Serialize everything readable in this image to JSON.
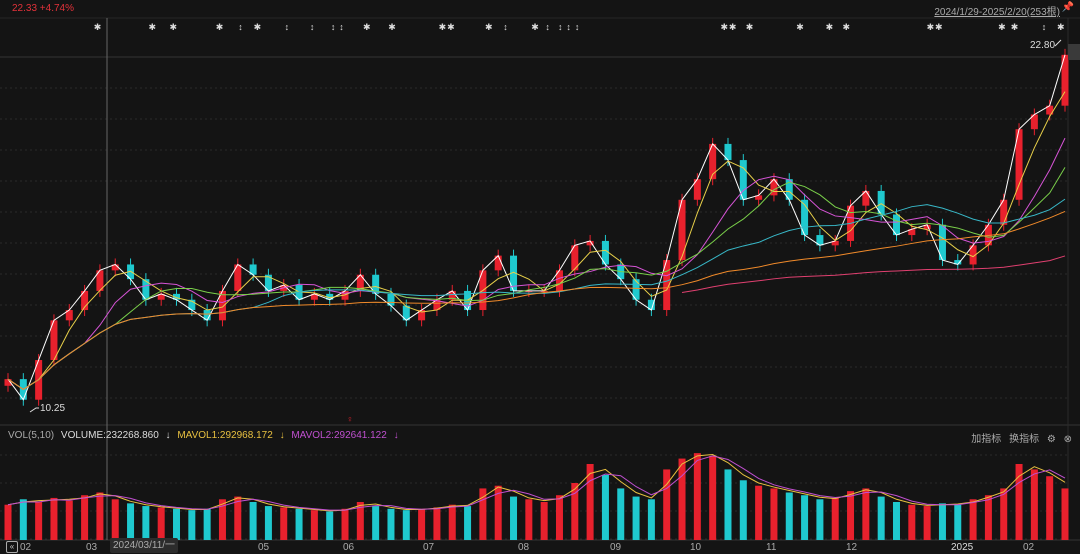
{
  "header": {
    "quote": "22.33 +4.74%",
    "range_label": "2024/1/29-2025/2/20(253根)",
    "pin_icon": "pin-icon"
  },
  "colors": {
    "up": "#e8212d",
    "down": "#1fc9cf",
    "ma_colors": [
      "#ffffff",
      "#e8d04a",
      "#d654d6",
      "#7ad04a",
      "#38b8c8",
      "#f08a2a",
      "#e04070"
    ],
    "vol_ma1": "#e8c040",
    "vol_ma2": "#c050d0"
  },
  "price_labels": {
    "low": "10.25",
    "high": "22.80"
  },
  "volume_header": {
    "name": "VOL(5,10)",
    "volume": "VOLUME:232268.860",
    "mavol1": "MAVOL1:292968.172",
    "mavol2": "MAVOL2:292641.122",
    "arrow": "↓",
    "add_indicator": "加指标",
    "switch_indicator": "换指标",
    "settings_icon": "gear-icon",
    "close_icon": "close-icon"
  },
  "x_axis": {
    "months": [
      "02",
      "03",
      "05",
      "06",
      "07",
      "08",
      "09",
      "10",
      "11",
      "12",
      "2025",
      "02"
    ],
    "crosshair_date": "2024/03/11/一",
    "back_icon": "double-chevron-left-icon"
  },
  "chart_data": {
    "type": "candlestick",
    "ylim": [
      10.25,
      22.8
    ],
    "closes": [
      11.3,
      10.6,
      11.95,
      13.3,
      13.65,
      14.3,
      15.0,
      15.2,
      14.7,
      14.0,
      14.2,
      14.0,
      13.65,
      13.3,
      14.3,
      15.2,
      14.85,
      14.3,
      14.5,
      14.0,
      14.2,
      14.0,
      14.3,
      14.85,
      14.2,
      13.8,
      13.3,
      13.65,
      14.0,
      14.3,
      13.65,
      15.0,
      15.5,
      14.3,
      14.3,
      14.3,
      15.0,
      15.85,
      16.0,
      15.2,
      14.7,
      14.0,
      13.65,
      15.35,
      17.4,
      18.1,
      19.3,
      18.75,
      17.4,
      17.55,
      18.1,
      17.4,
      16.2,
      15.85,
      16.0,
      17.2,
      17.7,
      16.9,
      16.2,
      16.4,
      16.55,
      15.35,
      15.2,
      15.85,
      16.55,
      17.4,
      19.8,
      20.3,
      20.6,
      22.33
    ],
    "volumes": [
      260000,
      300000,
      280000,
      310000,
      290000,
      330000,
      350000,
      300000,
      270000,
      250000,
      240000,
      230000,
      220000,
      230000,
      300000,
      320000,
      280000,
      250000,
      240000,
      230000,
      220000,
      210000,
      230000,
      280000,
      250000,
      230000,
      220000,
      230000,
      240000,
      260000,
      250000,
      380000,
      400000,
      320000,
      300000,
      280000,
      330000,
      420000,
      560000,
      480000,
      380000,
      320000,
      300000,
      520000,
      600000,
      640000,
      620000,
      520000,
      440000,
      400000,
      380000,
      350000,
      330000,
      300000,
      310000,
      360000,
      380000,
      320000,
      280000,
      260000,
      250000,
      270000,
      260000,
      300000,
      330000,
      380000,
      560000,
      520000,
      470000,
      380000
    ],
    "ma_periods": [
      5,
      10,
      20,
      30,
      60,
      120,
      250
    ],
    "markers": [
      {
        "type": "star",
        "index": 22
      },
      {
        "type": "star",
        "index": 35
      },
      {
        "type": "star",
        "index": 40
      },
      {
        "type": "star",
        "index": 51
      },
      {
        "type": "arrow",
        "index": 56
      },
      {
        "type": "star",
        "index": 60
      },
      {
        "type": "arrow",
        "index": 67
      },
      {
        "type": "arrow",
        "index": 73
      },
      {
        "type": "arrow",
        "index": 78
      },
      {
        "type": "arrow",
        "index": 80
      },
      {
        "type": "star",
        "index": 86
      },
      {
        "type": "star",
        "index": 92
      },
      {
        "type": "star",
        "index": 104
      },
      {
        "type": "star",
        "index": 106
      },
      {
        "type": "star",
        "index": 115
      },
      {
        "type": "arrow",
        "index": 119
      },
      {
        "type": "star",
        "index": 126
      },
      {
        "type": "arrow",
        "index": 129
      },
      {
        "type": "arrow",
        "index": 132
      },
      {
        "type": "arrow",
        "index": 134
      },
      {
        "type": "arrow",
        "index": 136
      },
      {
        "type": "star",
        "index": 171
      },
      {
        "type": "star",
        "index": 173
      },
      {
        "type": "star",
        "index": 177
      },
      {
        "type": "star",
        "index": 189
      },
      {
        "type": "star",
        "index": 196
      },
      {
        "type": "star",
        "index": 200
      },
      {
        "type": "star",
        "index": 220
      },
      {
        "type": "star",
        "index": 222
      },
      {
        "type": "star",
        "index": 237
      },
      {
        "type": "star",
        "index": 240
      },
      {
        "type": "arrow",
        "index": 247
      },
      {
        "type": "star",
        "index": 251
      }
    ]
  }
}
